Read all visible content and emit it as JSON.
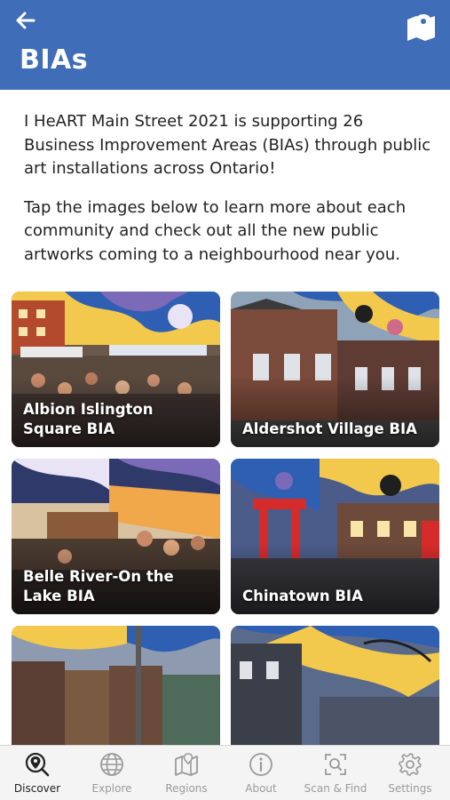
{
  "header": {
    "title": "BIAs",
    "back_icon": "arrow-left-icon",
    "map_icon": "map-marker-icon",
    "background": "#3f6db8"
  },
  "intro": {
    "paragraph1": "I HeART Main Street 2021 is supporting 26 Business Improvement Areas (BIAs) through public art installations across Ontario!",
    "paragraph2": "Tap the images below to learn more about each community and check out all the new public artworks coming to a neighbourhood near you."
  },
  "cards": [
    {
      "label": "Albion Islington Square BIA"
    },
    {
      "label": "Aldershot Village BIA"
    },
    {
      "label": "Belle River-On the Lake BIA"
    },
    {
      "label": "Chinatown BIA"
    },
    {
      "label": ""
    },
    {
      "label": ""
    }
  ],
  "tabs": [
    {
      "label": "Discover",
      "icon": "discover-icon",
      "active": true
    },
    {
      "label": "Explore",
      "icon": "globe-icon"
    },
    {
      "label": "Regions",
      "icon": "map-icon"
    },
    {
      "label": "About",
      "icon": "info-icon"
    },
    {
      "label": "Scan & Find",
      "icon": "scan-icon"
    },
    {
      "label": "Settings",
      "icon": "gear-icon"
    }
  ]
}
